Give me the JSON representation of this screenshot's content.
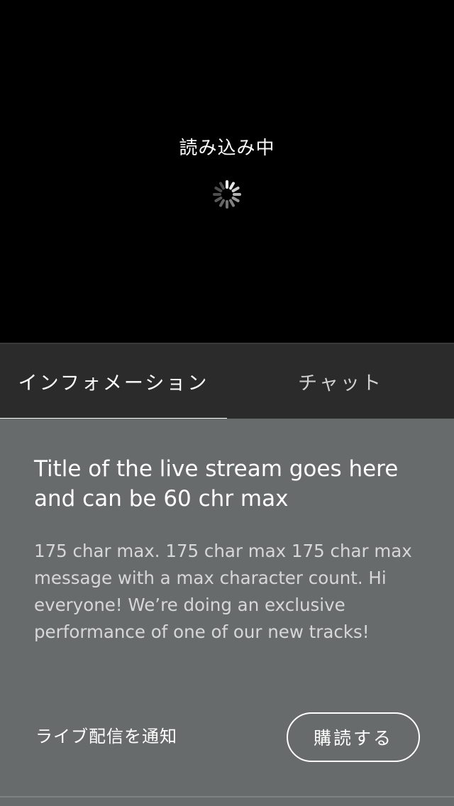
{
  "video": {
    "loading_text": "読み込み中"
  },
  "tabs": [
    {
      "label": "インフォメーション",
      "active": true
    },
    {
      "label": "チャット",
      "active": false
    }
  ],
  "info": {
    "title": "Title of the live stream goes here and can be 60 chr max",
    "description": "175 char max. 175 char max 175 char max message with a max character count. Hi everyone! We’re doing an exclusive performance of one of our new tracks!",
    "notify_label": "ライブ配信を通知",
    "subscribe_label": "購読する"
  },
  "colors": {
    "video_bg": "#000000",
    "tab_bar_bg": "#2b2b2b",
    "panel_bg": "#676b6b",
    "accent": "#ffffff"
  },
  "icons": {
    "loading": "spinner-icon"
  }
}
